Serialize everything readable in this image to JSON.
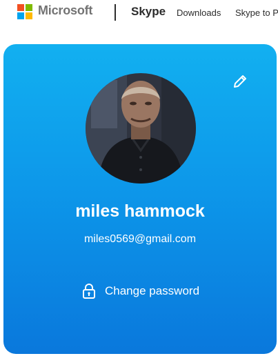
{
  "header": {
    "brand": "Microsoft",
    "product": "Skype",
    "nav": {
      "downloads": "Downloads",
      "skype_to": "Skype to Pl"
    }
  },
  "profile": {
    "name": "miles hammock",
    "email": "miles0569@gmail.com",
    "change_password_label": "Change password"
  },
  "icons": {
    "logo": "microsoft-logo",
    "edit": "pencil-icon",
    "lock": "lock-icon"
  },
  "colors": {
    "card_top": "#12b0f0",
    "card_bottom": "#0a78dc",
    "text_on_card": "#ffffff"
  }
}
